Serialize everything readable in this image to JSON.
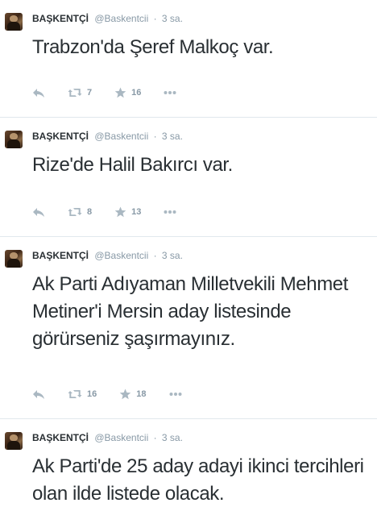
{
  "tweets": [
    {
      "fullname": "BAŞKENTÇİ",
      "username": "@Baskentcii",
      "separator": "·",
      "time": "3 sa.",
      "text": "Trabzon'da Şeref Malkoç var.",
      "retweets": "7",
      "favorites": "16"
    },
    {
      "fullname": "BAŞKENTÇİ",
      "username": "@Baskentcii",
      "separator": "·",
      "time": "3 sa.",
      "text": "Rize'de Halil Bakırcı var.",
      "retweets": "8",
      "favorites": "13"
    },
    {
      "fullname": "BAŞKENTÇİ",
      "username": "@Baskentcii",
      "separator": "·",
      "time": "3 sa.",
      "text": "Ak Parti Adıyaman Milletvekili Mehmet Metiner'i Mersin aday listesinde görürseniz şaşırmayınız.",
      "retweets": "16",
      "favorites": "18"
    },
    {
      "fullname": "BAŞKENTÇİ",
      "username": "@Baskentcii",
      "separator": "·",
      "time": "3 sa.",
      "text": "Ak Parti'de 25 aday adayi ikinci tercihleri olan ilde listede olacak."
    }
  ],
  "icons": {
    "reply": "reply-icon",
    "retweet": "retweet-icon",
    "favorite": "star-icon",
    "more": "more-icon",
    "avatar": "avatar"
  },
  "colors": {
    "text": "#292f33",
    "muted": "#8899a6",
    "divider": "#e1e8ed",
    "icon": "#aab8c2"
  }
}
